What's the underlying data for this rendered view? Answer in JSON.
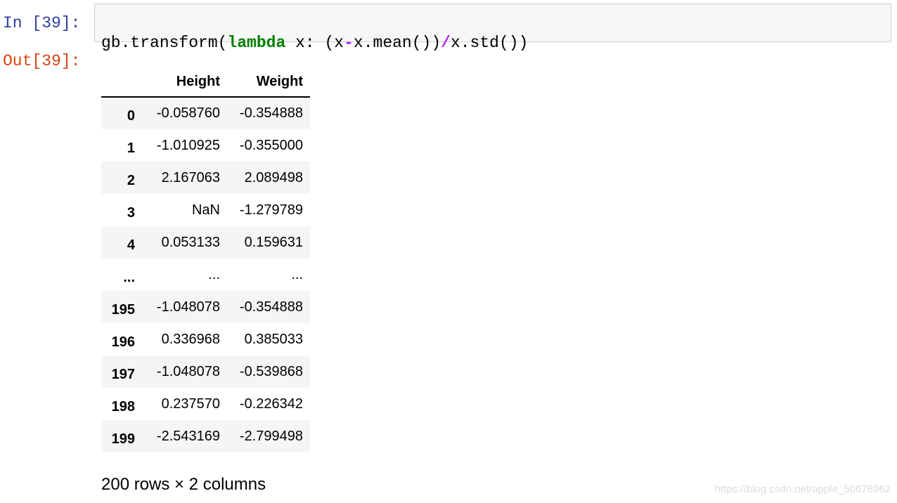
{
  "input_cell": {
    "prompt": "In [39]:",
    "code_tokens": [
      {
        "text": "gb.transform(",
        "kind": "plain"
      },
      {
        "text": "lambda",
        "kind": "keyword"
      },
      {
        "text": " x: (x",
        "kind": "plain"
      },
      {
        "text": "-",
        "kind": "operator"
      },
      {
        "text": "x.mean())",
        "kind": "plain"
      },
      {
        "text": "/",
        "kind": "operator"
      },
      {
        "text": "x.std())",
        "kind": "plain"
      }
    ]
  },
  "output_cell": {
    "prompt": "Out[39]:",
    "table": {
      "columns": [
        "",
        "Height",
        "Weight"
      ],
      "rows": [
        {
          "index": "0",
          "height": "-0.058760",
          "weight": "-0.354888"
        },
        {
          "index": "1",
          "height": "-1.010925",
          "weight": "-0.355000"
        },
        {
          "index": "2",
          "height": "2.167063",
          "weight": "2.089498"
        },
        {
          "index": "3",
          "height": "NaN",
          "weight": "-1.279789"
        },
        {
          "index": "4",
          "height": "0.053133",
          "weight": "0.159631"
        },
        {
          "index": "...",
          "height": "...",
          "weight": "..."
        },
        {
          "index": "195",
          "height": "-1.048078",
          "weight": "-0.354888"
        },
        {
          "index": "196",
          "height": "0.336968",
          "weight": "0.385033"
        },
        {
          "index": "197",
          "height": "-1.048078",
          "weight": "-0.539868"
        },
        {
          "index": "198",
          "height": "0.237570",
          "weight": "-0.226342"
        },
        {
          "index": "199",
          "height": "-2.543169",
          "weight": "-2.799498"
        }
      ]
    },
    "shape_text": "200 rows × 2 columns"
  },
  "watermark": "https://blog.csdn.net/apple_50678962",
  "colors": {
    "in_prompt": "#303f9f",
    "out_prompt": "#d84315",
    "keyword": "#008000",
    "operator": "#aa22ff",
    "stripe": "#f5f5f5"
  }
}
